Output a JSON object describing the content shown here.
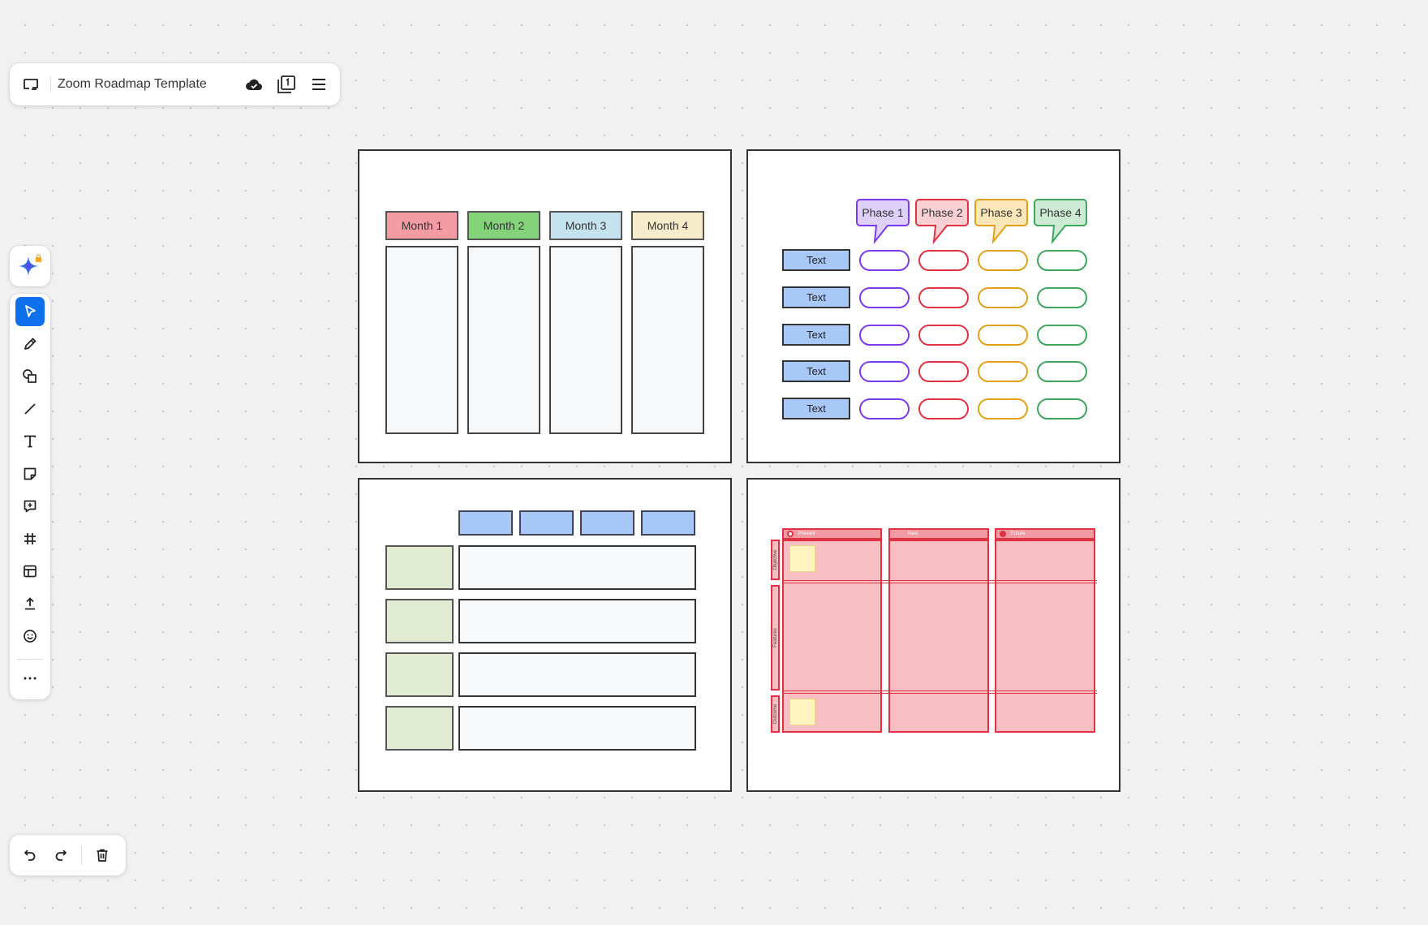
{
  "header": {
    "title": "Zoom Roadmap Template",
    "icons": [
      "window-icon",
      "cloud-check-icon",
      "page-one-icon",
      "menu-icon"
    ]
  },
  "toolbar": {
    "ai_icon": "ai-sparkle-icon",
    "tools": [
      "select",
      "pen",
      "shapes",
      "line",
      "text",
      "sticky-note",
      "comment",
      "frame",
      "template",
      "upload",
      "emoji",
      "more"
    ],
    "active_tool": "select",
    "accent": "#0e71eb"
  },
  "history": {
    "icons": [
      "undo-icon",
      "redo-icon",
      "trash-icon"
    ]
  },
  "frame1": {
    "months": [
      {
        "label": "Month 1",
        "color": "#f49ba4"
      },
      {
        "label": "Month 2",
        "color": "#84d27a"
      },
      {
        "label": "Month 3",
        "color": "#c5e3ef"
      },
      {
        "label": "Month 4",
        "color": "#f6eccb"
      }
    ]
  },
  "frame2": {
    "phases": [
      {
        "label": "Phase 1",
        "fill": "#ddd0fb",
        "stroke": "#7c3aed"
      },
      {
        "label": "Phase 2",
        "fill": "#fbd0d4",
        "stroke": "#e03243"
      },
      {
        "label": "Phase 3",
        "fill": "#fde6b8",
        "stroke": "#e0a21a"
      },
      {
        "label": "Phase 4",
        "fill": "#cdebd4",
        "stroke": "#3fa55f"
      }
    ],
    "rows": [
      "Text",
      "Text",
      "Text",
      "Text",
      "Text"
    ]
  },
  "frame4": {
    "columns": [
      "Present",
      "Next",
      "Future"
    ],
    "rows": [
      "Objective",
      "Features",
      "Outcome"
    ]
  }
}
